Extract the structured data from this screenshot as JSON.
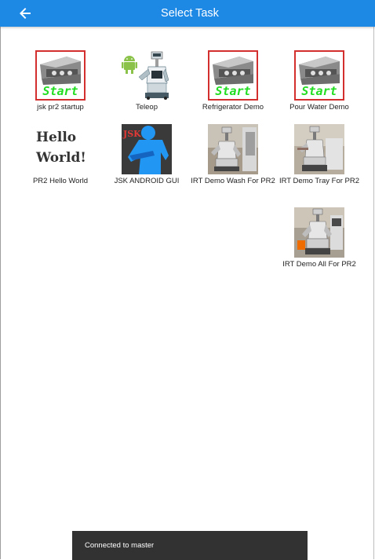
{
  "app_bar": {
    "title": "Select Task",
    "back_icon": "arrow-left-icon",
    "color": "#1e88e5"
  },
  "tasks": [
    {
      "label": "jsk pr2 startup",
      "icon": "start-robot-icon"
    },
    {
      "label": "Teleop",
      "icon": "android-robot-icon"
    },
    {
      "label": "Refrigerator Demo",
      "icon": "start-robot-icon"
    },
    {
      "label": "Pour Water Demo",
      "icon": "start-robot-icon"
    },
    {
      "label": "PR2 Hello World",
      "icon": "hello-world-icon",
      "image_text": "Hello World!"
    },
    {
      "label": "JSK ANDROID GUI",
      "icon": "jsk-person-icon",
      "image_text": "JSK"
    },
    {
      "label": "IRT Demo Wash For PR2",
      "icon": "robot-photo-icon"
    },
    {
      "label": "IRT Demo Tray For PR2",
      "icon": "robot-photo-icon"
    },
    {
      "label": "IRT Demo All For PR2",
      "icon": "robot-photo-icon"
    }
  ],
  "start_badge_text": "Start",
  "toast": {
    "message": "Connected to master"
  }
}
